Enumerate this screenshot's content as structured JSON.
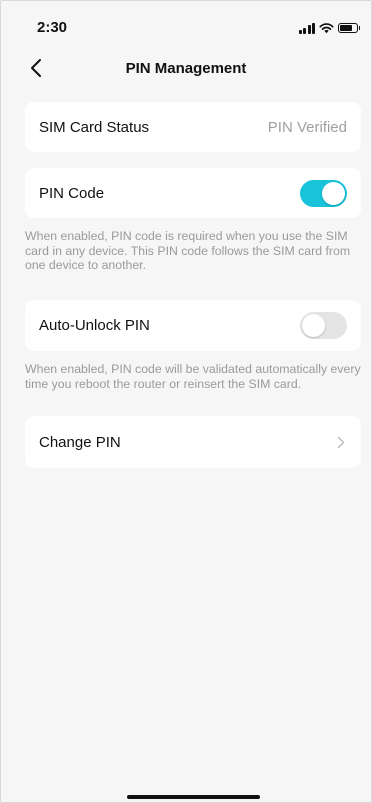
{
  "status_bar": {
    "time": "2:30",
    "icons": [
      "signal-icon",
      "wifi-icon",
      "battery-icon"
    ]
  },
  "nav": {
    "back_icon": "chevron-left-icon",
    "title": "PIN Management"
  },
  "sim_status": {
    "label": "SIM Card Status",
    "value": "PIN Verified"
  },
  "pin_code": {
    "label": "PIN Code",
    "enabled": true,
    "description": "When enabled, PIN code is required when you use the SIM card in any device. This PIN code follows the SIM card from one device to another."
  },
  "auto_unlock": {
    "label": "Auto-Unlock PIN",
    "enabled": false,
    "description": "When enabled, PIN code will be validated automatically every time you reboot the router or reinsert the SIM card."
  },
  "change_pin": {
    "label": "Change PIN",
    "chevron_icon": "chevron-right-icon"
  },
  "colors": {
    "accent": "#19c3d9",
    "background": "#f6f6f6",
    "card": "#ffffff",
    "secondary_text": "#9a9a9a"
  }
}
